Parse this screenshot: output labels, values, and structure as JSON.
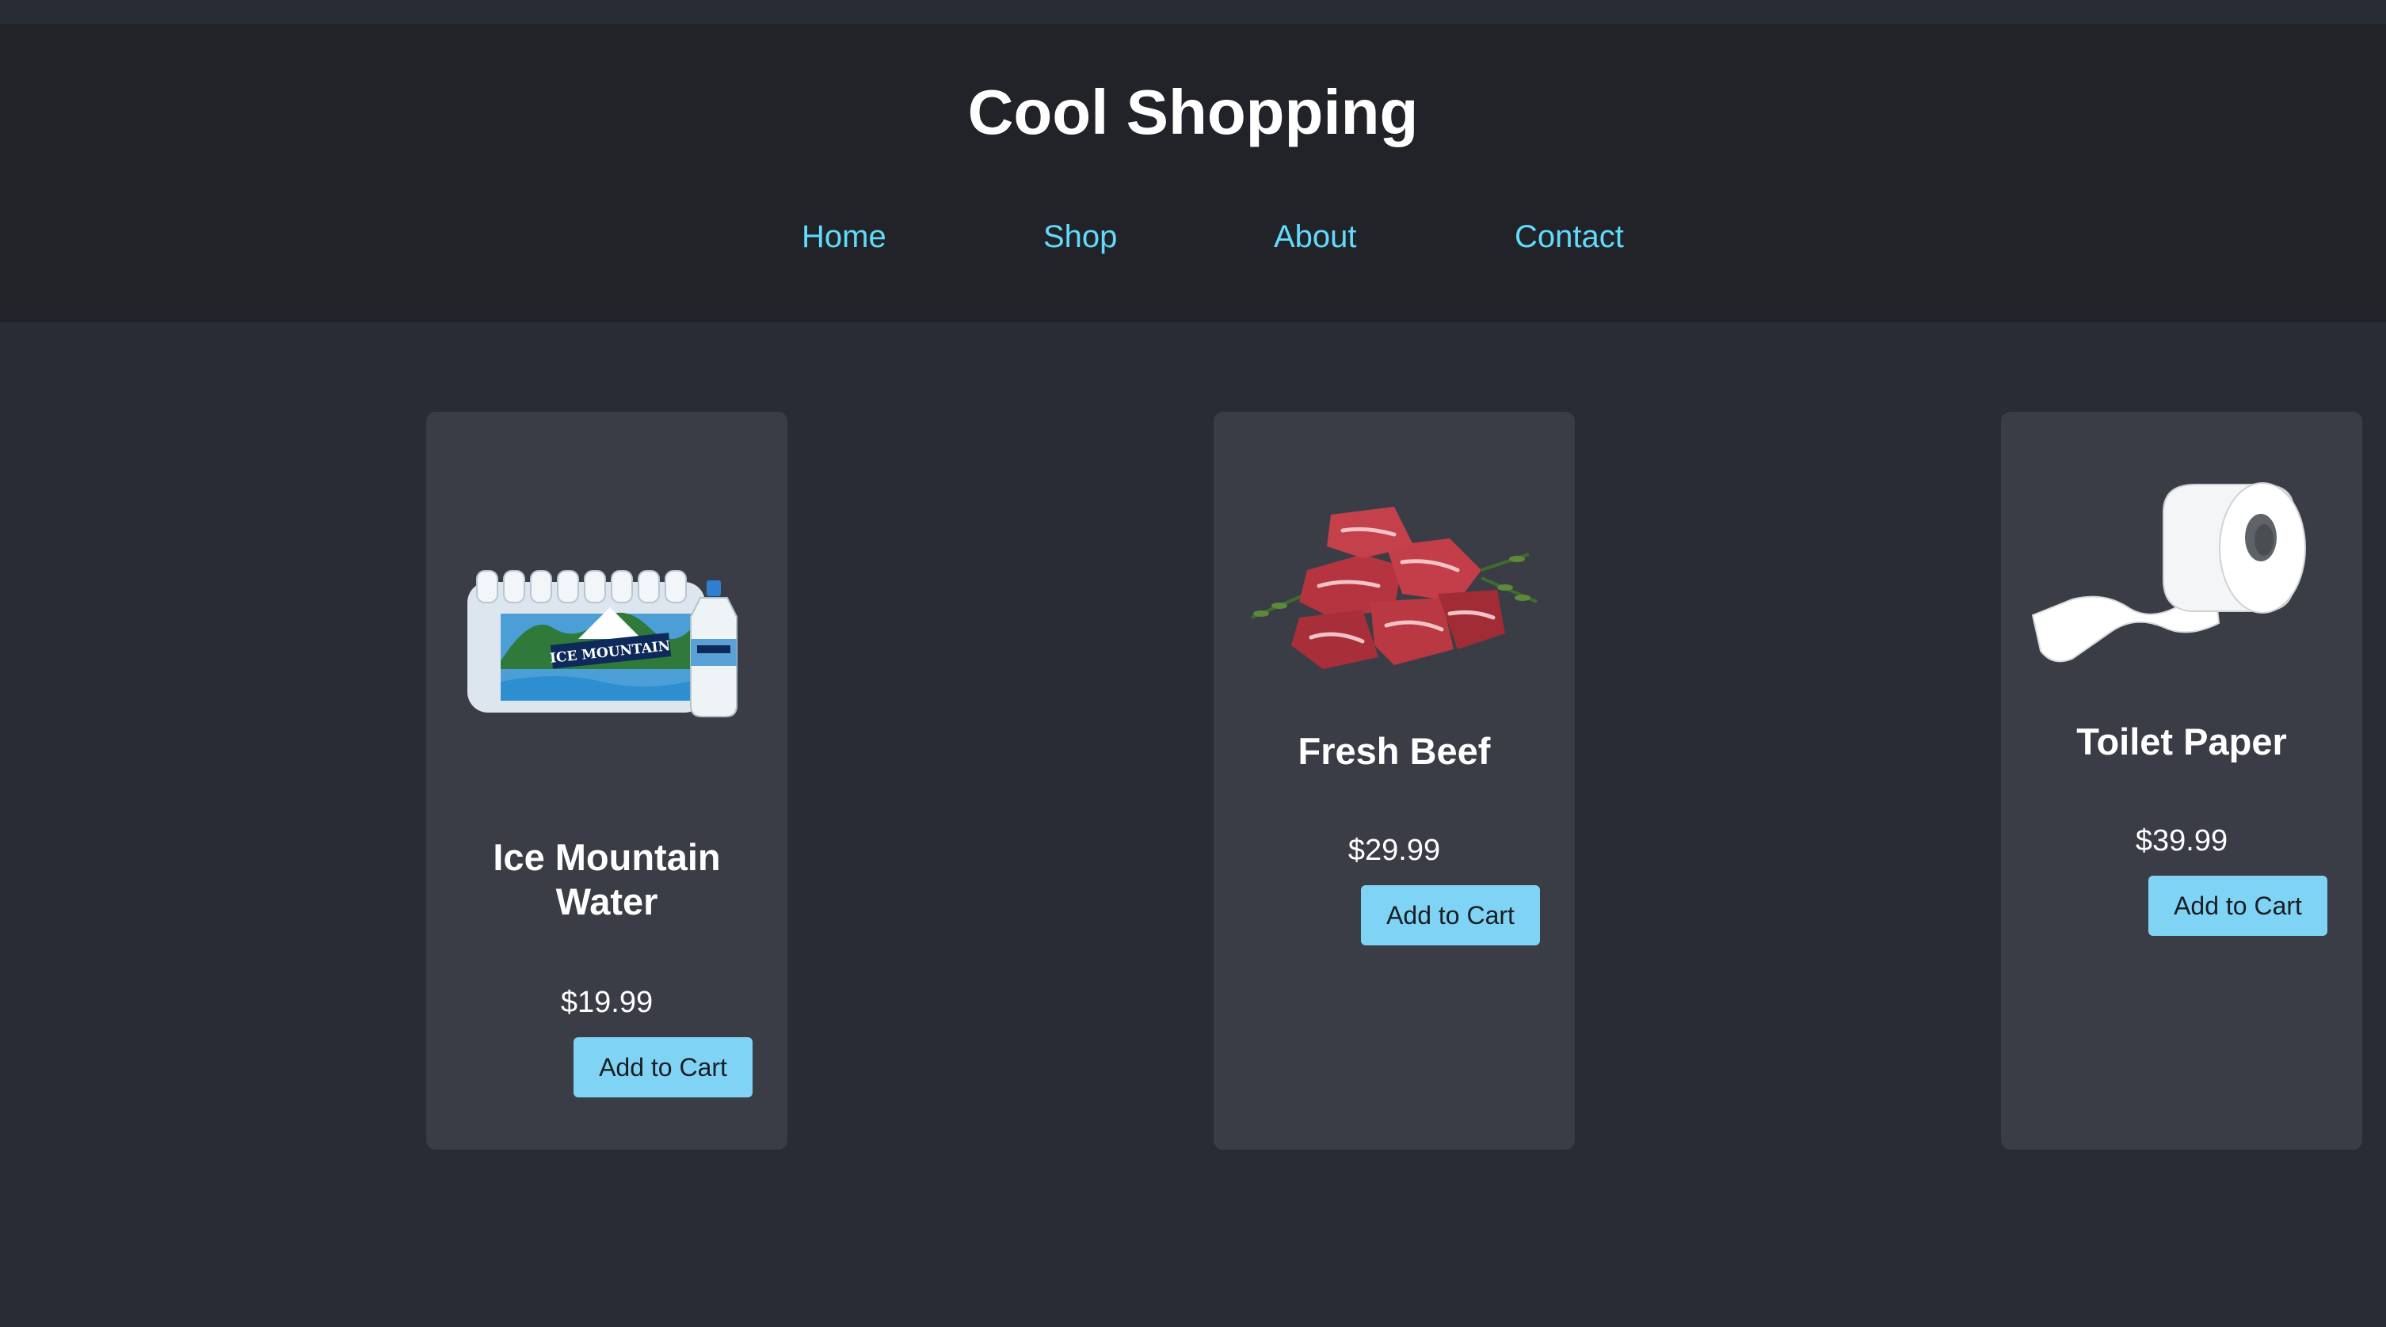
{
  "site": {
    "title": "Cool Shopping"
  },
  "nav": [
    "Home",
    "Shop",
    "About",
    "Contact"
  ],
  "products": [
    {
      "name_line1": "Ice Mountain",
      "name_line2": "Water",
      "image_text": "ICE MOUNTAIN",
      "price": "$19.99",
      "button": "Add to Cart"
    },
    {
      "name": "Fresh Beef",
      "price": "$29.99",
      "button": "Add to Cart"
    },
    {
      "name": "Toilet Paper",
      "price": "$39.99",
      "button": "Add to Cart"
    }
  ],
  "colors": {
    "page_background": "#282c34",
    "header_background": "#212328",
    "card_background": "#3a3d46",
    "nav_link": "#61dafb",
    "button_background": "#7fd4f6"
  }
}
